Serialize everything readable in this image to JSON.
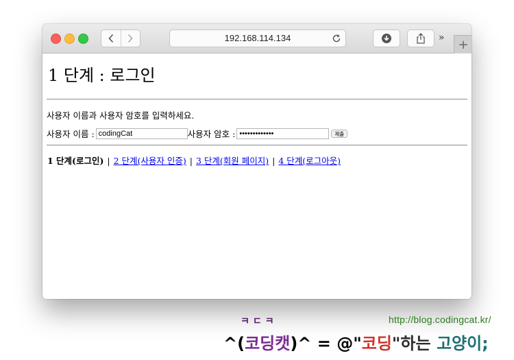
{
  "browser": {
    "address": "192.168.114.134"
  },
  "page": {
    "title": "1 단계 : 로그인",
    "instruction": "사용자 이름과 사용자 암호를 입력하세요.",
    "username_label": "사용자 이름 :",
    "username_value": "codingCat",
    "password_label": "사용자 암호 :",
    "password_value": "•••••••••••••",
    "submit_label": "제출",
    "steps": {
      "current": "1 단계(로그인)",
      "sep": "|",
      "step2": "2 단계(사용자 인증)",
      "step3": "3 단계(회원 페이지)",
      "step4": "4 단계(로그아웃)"
    }
  },
  "watermark": {
    "url": "http://blog.codingcat.kr/",
    "top": "ㅋㄷㅋ",
    "slogan_a": "^(",
    "slogan_b": "코딩캣",
    "slogan_c": ")^ = @\"",
    "slogan_d": "코딩",
    "slogan_e": "\"하는 ",
    "slogan_f": "고양이;"
  },
  "colors": {
    "link": "#0000ee",
    "traffic_red": "#fc605c",
    "traffic_yellow": "#fdbc40",
    "traffic_green": "#34c84a"
  }
}
